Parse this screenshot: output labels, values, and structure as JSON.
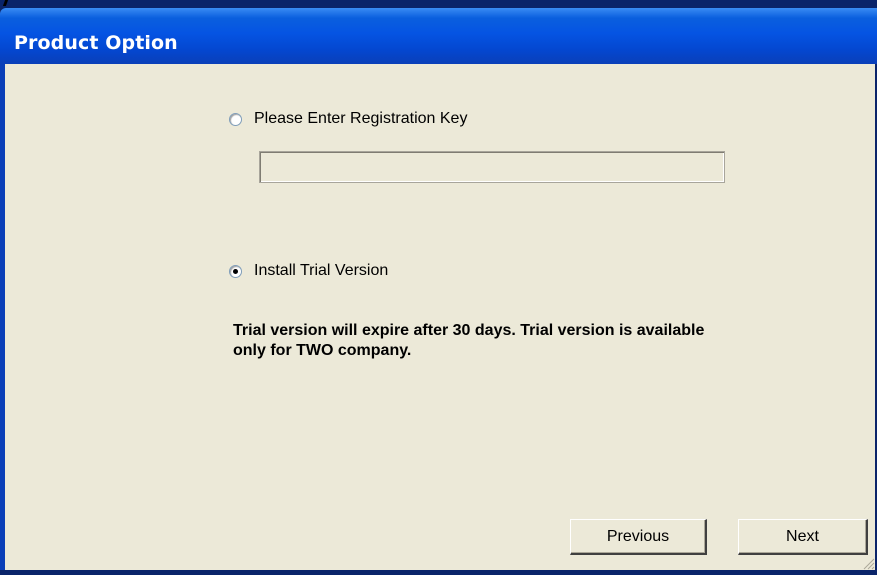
{
  "window": {
    "title": "Product Option"
  },
  "options": {
    "registration": {
      "label": "Please Enter Registration Key",
      "selected": false,
      "key_value": ""
    },
    "trial": {
      "label": "Install Trial Version",
      "selected": true
    }
  },
  "note": {
    "line1": "Trial version will expire after 30 days. Trial version is available",
    "line2": "only for TWO company."
  },
  "buttons": {
    "previous_label": "Previous",
    "next_label": "Next"
  },
  "colors": {
    "titlebar": "#0554e3",
    "client_bg": "#ece9d8"
  }
}
